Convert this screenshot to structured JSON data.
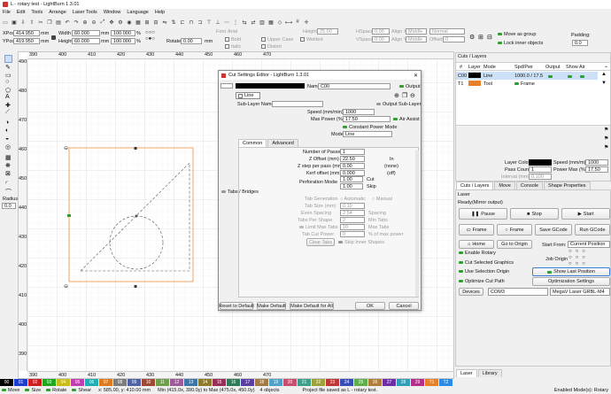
{
  "app": {
    "title": "L - rotary test - LightBurn 1.3.01"
  },
  "menu": [
    "File",
    "Edit",
    "Tools",
    "Arrange",
    "Laser Tools",
    "Window",
    "Language",
    "Help"
  ],
  "props": {
    "xpos_label": "XPos",
    "xpos": "414.950",
    "ypos_label": "YPos",
    "ypos": "419.950",
    "width_label": "Width",
    "width": "60.000",
    "height_label": "Height",
    "height": "60.000",
    "unit": "mm",
    "scale_w": "100.000",
    "scale_h": "100.000",
    "pct": "%",
    "rotate_label": "Rotate",
    "rotate": "0.00",
    "rotate_unit": "mm"
  },
  "text_opts": {
    "font_label": "Font",
    "font": "Arial",
    "height_label": "Height",
    "height": "25.00",
    "hspace_label": "HSpace",
    "hspace": "0.00",
    "vspace_label": "VSpace",
    "vspace": "0.00",
    "align_x_label": "Align X",
    "align_x": "Middle",
    "align_y_label": "Align Y",
    "align_y": "Middle",
    "normal": "Normal",
    "offset_label": "Offset",
    "offset": "0",
    "bold": "Bold",
    "italic": "Italic",
    "upper_case": "Upper Case",
    "welded": "Welded",
    "distort": "Distort"
  },
  "move_opts": {
    "move_as_group": "Move as group",
    "lock_inner": "Lock inner objects",
    "padding_label": "Padding:",
    "padding": "0.0"
  },
  "canvas": {
    "top_ruler": [
      "390",
      "400",
      "410",
      "420",
      "430",
      "440",
      "450",
      "460",
      "470"
    ],
    "bottom_ruler": [
      "390",
      "400",
      "410",
      "420",
      "430",
      "440",
      "450",
      "460",
      "470"
    ],
    "left_ruler": [
      "490",
      "480",
      "470",
      "460",
      "450",
      "440",
      "430",
      "420",
      "410",
      "400",
      "390",
      "380"
    ],
    "radius_label": "Radius:",
    "radius": "0.0"
  },
  "dialog": {
    "title": "Cut Settings Editor - LightBurn 1.3.01",
    "name_label": "Name",
    "name": "C00",
    "output_label": "Output",
    "layer_mode": "Line",
    "sublayer_label": "Sub-Layer Name",
    "output_sublayer": "Output Sub-Layer",
    "speed_label": "Speed (mm/min)",
    "speed": "1000",
    "maxpower_label": "Max Power (%)",
    "maxpower": "17.50",
    "air_assist": "Air Assist",
    "const_power": "Constant Power Mode",
    "mode_label": "Mode",
    "mode": "Line",
    "tab_common": "Common",
    "tab_advanced": "Advanced",
    "passes_label": "Number of Passes",
    "passes": "1",
    "zoffset_label": "Z Offset (mm)",
    "zoffset": "22.50",
    "zoffset_note": "In",
    "zstep_label": "Z step per pass (mm)",
    "zstep": "0.00",
    "zstep_note": "(none)",
    "kerf_label": "Kerf offset (mm)",
    "kerf": "0.000",
    "kerf_note": "(off)",
    "perf_label": "Perforation Mode",
    "perf_cut": "1.00",
    "perf_cut_label": "Cut",
    "perf_skip": "1.00",
    "perf_skip_label": "Skip",
    "tabs_label": "Tabs / Bridges",
    "tabgen_label": "Tab Generation",
    "tabgen_auto": "Automatic",
    "tabgen_manual": "Manual",
    "tabsize_label": "Tab Size (mm)",
    "tabsize": "0.10",
    "evenspacing_label": "Even Spacing",
    "evenspacing": "2.54",
    "spacing": "Spacing",
    "tabspershape_label": "Tabs Per Shape",
    "tabspershape": "2",
    "mintabs": "Min Tabs",
    "limitmax_label": "Limit Max Tabs",
    "limitmax": "10",
    "maxtabs": "Max Tabs",
    "tabcutpower_label": "Tab Cut Power",
    "tabcutpower": "0",
    "pct_max": "% of max power",
    "clear_tabs": "Clear Tabs",
    "skip_inner": "Skip Inner Shapes",
    "reset": "Reset to Default",
    "make_default": "Make Default",
    "make_default_all": "Make Default for All",
    "ok": "OK",
    "cancel": "Cancel"
  },
  "cuts": {
    "title": "Cuts / Layers",
    "headers": [
      "#",
      "Layer",
      "Mode",
      "Spd/Pwr",
      "Output",
      "Show",
      "Air"
    ],
    "rows": [
      {
        "num": "C00",
        "color": "#000000",
        "mode": "Line",
        "spdpwr": "1000.0 / 17.5"
      },
      {
        "num": "T1",
        "color": "#e8822a",
        "mode": "Tool",
        "spdpwr": "Frame"
      }
    ],
    "layer_color_label": "Layer Color",
    "speed_label": "Speed (mm/m)",
    "speed": "1000",
    "pass_label": "Pass Count",
    "pass": "1",
    "power_label": "Power Max (%)",
    "power": "17.50",
    "interval_label": "Interval (mm)",
    "interval": "0.100"
  },
  "tabs_row1": [
    "Cuts / Layers",
    "Move",
    "Console",
    "Shape Properties"
  ],
  "laser": {
    "title": "Laser",
    "ready": "Ready",
    "mirror": "(Mirror output)",
    "pause": "Pause",
    "stop": "Stop",
    "start": "Start",
    "frame1": "Frame",
    "frame2": "Frame",
    "save_gcode": "Save GCode",
    "run_gcode": "Run GCode",
    "home": "Home",
    "go_origin": "Go to Origin",
    "start_from_label": "Start From:",
    "start_from": "Current Position",
    "job_origin_label": "Job Origin",
    "enable_rotary": "Enable Rotary",
    "cut_selected": "Cut Selected Graphics",
    "use_selection_origin": "Use Selection Origin",
    "show_last": "Show Last Position",
    "optimize": "Optimize Cut Path",
    "opt_settings": "Optimization Settings",
    "devices": "Devices",
    "port": "COM3",
    "device": "MegaV Laser GRBL-M4"
  },
  "bottom_tabs": [
    "Laser",
    "Library"
  ],
  "palette": [
    {
      "label": "00",
      "color": "#000000"
    },
    {
      "label": "01",
      "color": "#1d3ed1"
    },
    {
      "label": "02",
      "color": "#d11d1d"
    },
    {
      "label": "03",
      "color": "#21a821"
    },
    {
      "label": "04",
      "color": "#c9bd1a"
    },
    {
      "label": "05",
      "color": "#c23fb3"
    },
    {
      "label": "06",
      "color": "#1fb0b5"
    },
    {
      "label": "07",
      "color": "#e07a1f"
    },
    {
      "label": "08",
      "color": "#7d7d7d"
    },
    {
      "label": "09",
      "color": "#5163a4"
    },
    {
      "label": "10",
      "color": "#a04a35"
    },
    {
      "label": "11",
      "color": "#6ea14a"
    },
    {
      "label": "12",
      "color": "#a05a9b"
    },
    {
      "label": "13",
      "color": "#3d77a8"
    },
    {
      "label": "14",
      "color": "#8e7b2b"
    },
    {
      "label": "15",
      "color": "#9b2f5a"
    },
    {
      "label": "16",
      "color": "#2e7c58"
    },
    {
      "label": "17",
      "color": "#5b3da3"
    },
    {
      "label": "18",
      "color": "#a37b43"
    },
    {
      "label": "19",
      "color": "#4fa3c9"
    },
    {
      "label": "20",
      "color": "#c94f6e"
    },
    {
      "label": "21",
      "color": "#3ea08c"
    },
    {
      "label": "22",
      "color": "#9fa23b"
    },
    {
      "label": "23",
      "color": "#c03737"
    },
    {
      "label": "24",
      "color": "#384fb7"
    },
    {
      "label": "25",
      "color": "#5fb04d"
    },
    {
      "label": "26",
      "color": "#b07f3a"
    },
    {
      "label": "27",
      "color": "#6f2da8"
    },
    {
      "label": "28",
      "color": "#2fa0b5"
    },
    {
      "label": "29",
      "color": "#b52f8b"
    },
    {
      "label": "T1",
      "color": "#e8822a"
    },
    {
      "label": "T2",
      "color": "#2a8be8"
    }
  ],
  "status": {
    "move": "Move",
    "size": "Size",
    "rotate": "Rotate",
    "shear": "Shear",
    "coords": "x: 585.00, y: 410.00 mm",
    "range": "Min (415.0x, 390.0y) to Max (475.0x, 450.0y)",
    "objects": "4 objects",
    "saved": "Project file saved as L - rotary test.",
    "modes": "Enabled Mode(s): Rotary"
  }
}
